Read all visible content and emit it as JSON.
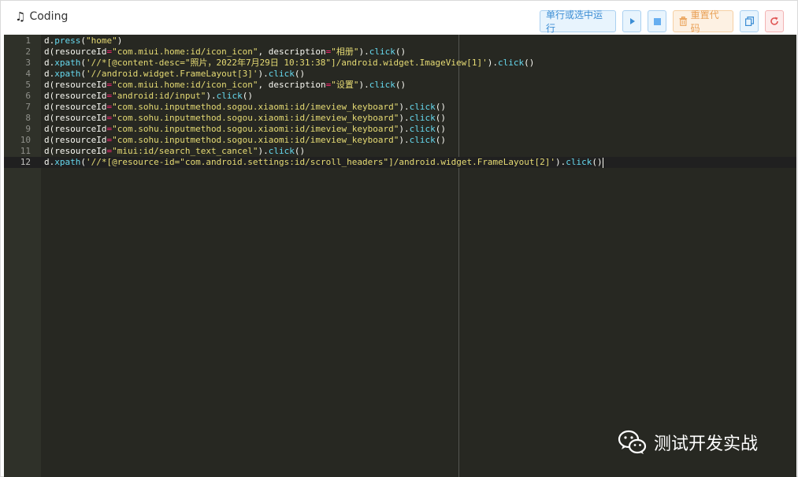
{
  "panel": {
    "title": "Coding",
    "title_icon": "music-note-icon"
  },
  "toolbar": {
    "run_selection_label": "单行或选中运行",
    "play_icon": "play-icon",
    "stop_icon": "stop-icon",
    "reset_label": "重置代码",
    "reset_icon": "trash-icon",
    "copy_icon": "copy-icon",
    "reload_icon": "reload-icon",
    "colors": {
      "primary": "#3c8dd4",
      "warning": "#e9a055",
      "danger": "#e05555"
    }
  },
  "editor": {
    "theme_colors": {
      "background": "#272822",
      "function": "#66d9ef",
      "string": "#e6db74",
      "operator": "#f92672"
    },
    "active_line": 12,
    "lines": [
      {
        "n": "1",
        "segs": [
          [
            "d.",
            ""
          ],
          [
            "press",
            "fn"
          ],
          [
            "(",
            ""
          ],
          [
            "\"home\"",
            "str"
          ],
          [
            ")",
            ""
          ]
        ]
      },
      {
        "n": "2",
        "segs": [
          [
            "d(resourceId",
            ""
          ],
          [
            "=",
            "kw"
          ],
          [
            "\"com.miui.home:id/icon_icon\"",
            "str"
          ],
          [
            ", description",
            ""
          ],
          [
            "=",
            "kw"
          ],
          [
            "\"相册\"",
            "str"
          ],
          [
            ").",
            ""
          ],
          [
            "click",
            "fn"
          ],
          [
            "()",
            ""
          ]
        ]
      },
      {
        "n": "3",
        "segs": [
          [
            "d.",
            ""
          ],
          [
            "xpath",
            "fn"
          ],
          [
            "(",
            ""
          ],
          [
            "'//*[@content-desc=\"照片，2022年7月29日 10:31:38\"]/android.widget.ImageView[1]'",
            "str"
          ],
          [
            ").",
            ""
          ],
          [
            "click",
            "fn"
          ],
          [
            "()",
            ""
          ]
        ]
      },
      {
        "n": "4",
        "segs": [
          [
            "d.",
            ""
          ],
          [
            "xpath",
            "fn"
          ],
          [
            "(",
            ""
          ],
          [
            "'//android.widget.FrameLayout[3]'",
            "str"
          ],
          [
            ").",
            ""
          ],
          [
            "click",
            "fn"
          ],
          [
            "()",
            ""
          ]
        ]
      },
      {
        "n": "5",
        "segs": [
          [
            "d(resourceId",
            ""
          ],
          [
            "=",
            "kw"
          ],
          [
            "\"com.miui.home:id/icon_icon\"",
            "str"
          ],
          [
            ", description",
            ""
          ],
          [
            "=",
            "kw"
          ],
          [
            "\"设置\"",
            "str"
          ],
          [
            ").",
            ""
          ],
          [
            "click",
            "fn"
          ],
          [
            "()",
            ""
          ]
        ]
      },
      {
        "n": "6",
        "segs": [
          [
            "d(resourceId",
            ""
          ],
          [
            "=",
            "kw"
          ],
          [
            "\"android:id/input\"",
            "str"
          ],
          [
            ").",
            ""
          ],
          [
            "click",
            "fn"
          ],
          [
            "()",
            ""
          ]
        ]
      },
      {
        "n": "7",
        "segs": [
          [
            "d(resourceId",
            ""
          ],
          [
            "=",
            "kw"
          ],
          [
            "\"com.sohu.inputmethod.sogou.xiaomi:id/imeview_keyboard\"",
            "str"
          ],
          [
            ").",
            ""
          ],
          [
            "click",
            "fn"
          ],
          [
            "()",
            ""
          ]
        ]
      },
      {
        "n": "8",
        "segs": [
          [
            "d(resourceId",
            ""
          ],
          [
            "=",
            "kw"
          ],
          [
            "\"com.sohu.inputmethod.sogou.xiaomi:id/imeview_keyboard\"",
            "str"
          ],
          [
            ").",
            ""
          ],
          [
            "click",
            "fn"
          ],
          [
            "()",
            ""
          ]
        ]
      },
      {
        "n": "9",
        "segs": [
          [
            "d(resourceId",
            ""
          ],
          [
            "=",
            "kw"
          ],
          [
            "\"com.sohu.inputmethod.sogou.xiaomi:id/imeview_keyboard\"",
            "str"
          ],
          [
            ").",
            ""
          ],
          [
            "click",
            "fn"
          ],
          [
            "()",
            ""
          ]
        ]
      },
      {
        "n": "10",
        "segs": [
          [
            "d(resourceId",
            ""
          ],
          [
            "=",
            "kw"
          ],
          [
            "\"com.sohu.inputmethod.sogou.xiaomi:id/imeview_keyboard\"",
            "str"
          ],
          [
            ").",
            ""
          ],
          [
            "click",
            "fn"
          ],
          [
            "()",
            ""
          ]
        ]
      },
      {
        "n": "11",
        "segs": [
          [
            "d(resourceId",
            ""
          ],
          [
            "=",
            "kw"
          ],
          [
            "\"miui:id/search_text_cancel\"",
            "str"
          ],
          [
            ").",
            ""
          ],
          [
            "click",
            "fn"
          ],
          [
            "()",
            ""
          ]
        ]
      },
      {
        "n": "12",
        "segs": [
          [
            "d.",
            ""
          ],
          [
            "xpath",
            "fn"
          ],
          [
            "(",
            ""
          ],
          [
            "'//*[@resource-id=\"com.android.settings:id/scroll_headers\"]/android.widget.FrameLayout[2]'",
            "str"
          ],
          [
            ").",
            ""
          ],
          [
            "click",
            "fn"
          ],
          [
            "()",
            ""
          ]
        ]
      }
    ]
  },
  "watermark": {
    "text": "测试开发实战",
    "icon": "wechat-icon"
  }
}
